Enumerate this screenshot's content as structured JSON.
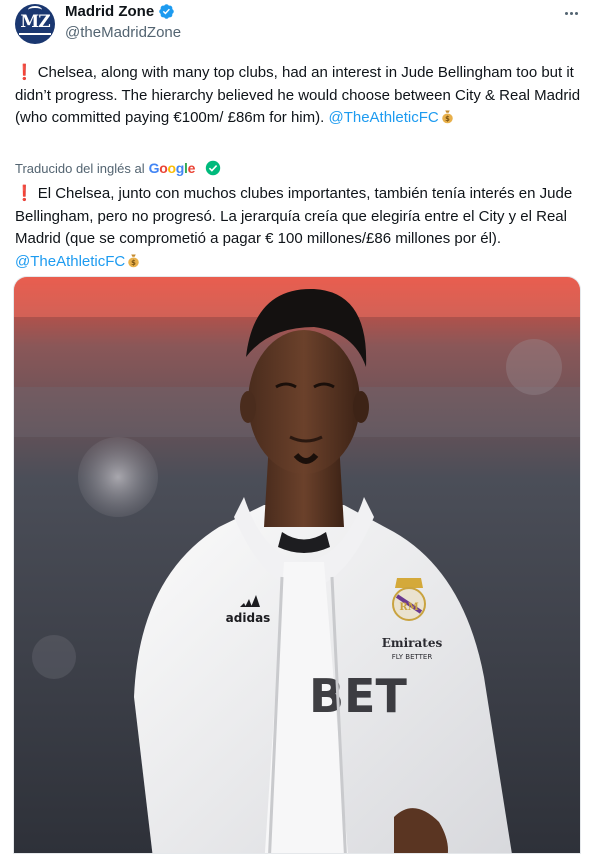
{
  "account": {
    "name": "Madrid Zone",
    "handle": "@theMadridZone",
    "avatar_text": "MZ"
  },
  "tweet": {
    "original_text": "Chelsea, along with many top clubs, had an interest in Jude Bellingham too but it didn’t progress. The hierarchy believed he would choose between City & Real Madrid (who committed paying €100m/ £86m for him).",
    "original_mention": "@TheAthleticFC",
    "translated_label": "Traducido del inglés al",
    "translated_text": "El Chelsea, junto con muchos clubes importantes, también tenía interés en Jude Bellingham, pero no progresó. La jerarquía creía que elegiría entre el City y el Real Madrid (que se comprometió a pagar € 100 millones/£86 millones por él).",
    "translated_mention": "@TheAthleticFC"
  },
  "icons": {
    "alert": "red-exclamation-icon",
    "money": "money-bag-icon",
    "verified": "verified-badge-icon",
    "more": "more-options-icon",
    "google": "google-logo",
    "check": "verified-check-icon"
  },
  "photo": {
    "sponsor_text": "Emirates",
    "sponsor_sub": "FLY BETTER",
    "brand_text": "adidas",
    "shirt_text": "BET"
  },
  "colors": {
    "link": "#1d9bf0",
    "verified": "#1d9bf0",
    "alert": "#d9242a",
    "muted": "#536471"
  }
}
